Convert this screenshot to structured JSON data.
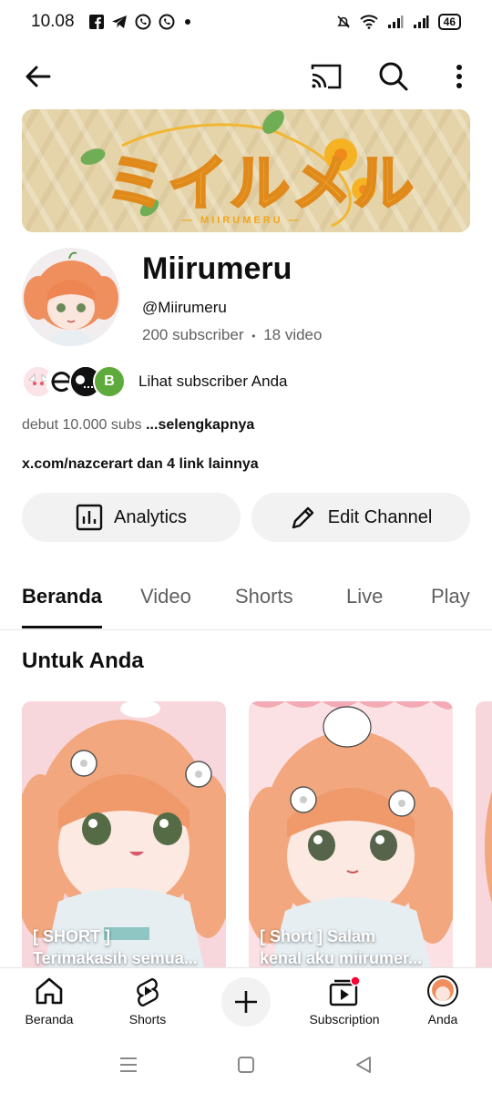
{
  "status_bar": {
    "time": "10.08",
    "battery": "46"
  },
  "banner": {
    "title": "ミイルメル",
    "subtitle": "— MIIRUMERU —"
  },
  "channel": {
    "name": "Miirumeru",
    "handle": "@Miirumeru",
    "subscribers": "200 subscriber",
    "separator": "•",
    "videos": "18 video",
    "subs_link": "Lihat subscriber Anda",
    "description": "debut 10.000 subs ",
    "description_more": "...selengkapnya",
    "link_text": "x.com/nazcerart dan 4 link lainnya",
    "mini_avatar_letter": "B"
  },
  "actions": {
    "analytics": "Analytics",
    "edit": "Edit Channel"
  },
  "tabs": [
    "Beranda",
    "Video",
    "Shorts",
    "Live",
    "Play"
  ],
  "section_title": "Untuk Anda",
  "shorts": [
    {
      "line1": "[ SHORT ]",
      "line2": "Terimakasih semua..."
    },
    {
      "line1": "[ Short ] Salam",
      "line2": "kenal aku miirumer..."
    }
  ],
  "bottom_nav": {
    "home": "Beranda",
    "shorts": "Shorts",
    "subscription": "Subscription",
    "you": "Anda"
  },
  "colors": {
    "accent_red": "#ff0033",
    "text_primary": "#0f0f0f",
    "text_secondary": "#606060",
    "chip_bg": "#f2f2f2"
  }
}
